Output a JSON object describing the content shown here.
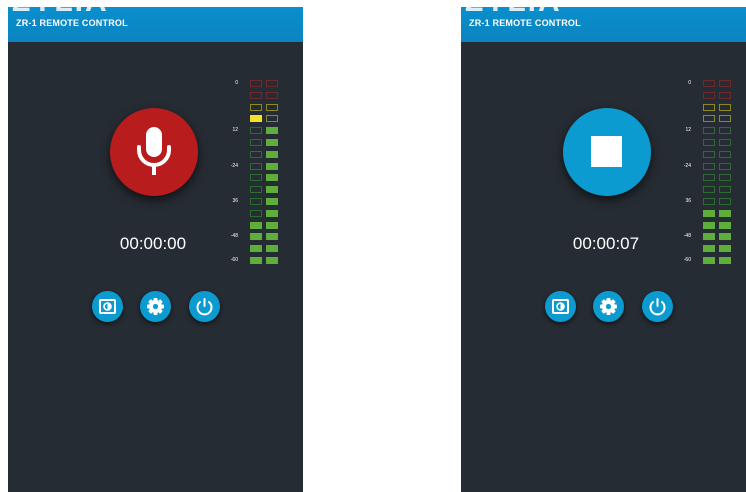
{
  "app": {
    "logo_text": "ZYLIA",
    "title": "ZR-1 REMOTE CONTROL"
  },
  "colors": {
    "header": "#0a8fcd",
    "background": "#262c33",
    "record_button": "#b81c1c",
    "stop_button": "#0b9bd0",
    "meter_green": "#5fae3b",
    "meter_yellow": "#f4e12a"
  },
  "meter_scale": [
    "0",
    "12",
    "-24",
    "36",
    "-48",
    "-60"
  ],
  "screens": [
    {
      "state": "idle",
      "main_button_icon": "microphone-icon",
      "timer": "00:00:00",
      "meter_level_segments": [
        4,
        12
      ],
      "meter_yellow_lit_left": true
    },
    {
      "state": "recording",
      "main_button_icon": "stop-icon",
      "timer": "00:00:07",
      "meter_level_segments": [
        5,
        5
      ],
      "meter_yellow_lit_left": false
    }
  ],
  "bottom_buttons": [
    {
      "icon": "brightness-icon"
    },
    {
      "icon": "settings-gear-icon"
    },
    {
      "icon": "power-icon"
    }
  ]
}
